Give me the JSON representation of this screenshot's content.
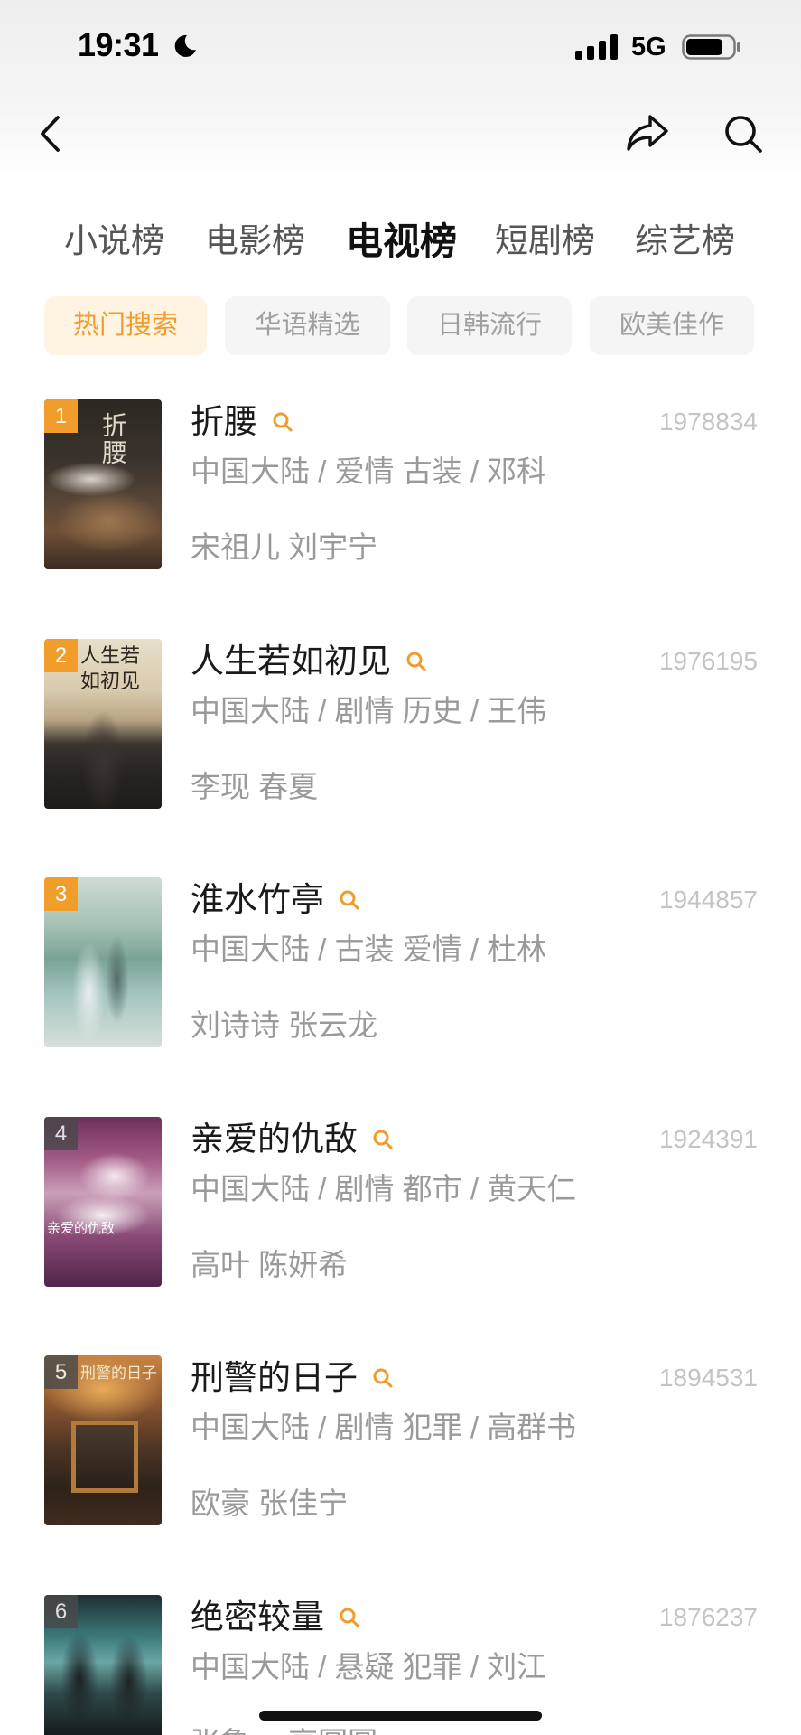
{
  "status_bar": {
    "time": "19:31",
    "network": "5G",
    "signal_bars": 4,
    "battery_level": 0.8,
    "icons": {
      "focus": "moon-icon",
      "signal": "signal-icon",
      "battery": "battery-icon"
    }
  },
  "nav": {
    "back_icon": "chevron-left-icon",
    "share_icon": "share-icon",
    "search_icon": "search-icon"
  },
  "category_tabs": [
    {
      "label": "小说榜",
      "active": false
    },
    {
      "label": "电影榜",
      "active": false
    },
    {
      "label": "电视榜",
      "active": true
    },
    {
      "label": "短剧榜",
      "active": false
    },
    {
      "label": "综艺榜",
      "active": false
    }
  ],
  "filter_chips": [
    {
      "label": "热门搜索",
      "active": true
    },
    {
      "label": "华语精选",
      "active": false
    },
    {
      "label": "日韩流行",
      "active": false
    },
    {
      "label": "欧美佳作",
      "active": false
    }
  ],
  "rank_list": [
    {
      "rank": "1",
      "title": "折腰",
      "count": "1978834",
      "meta": "中国大陆 / 爱情 古装 / 邓科",
      "cast": "宋祖儿 刘宇宁",
      "poster_text": "折腰"
    },
    {
      "rank": "2",
      "title": "人生若如初见",
      "count": "1976195",
      "meta": "中国大陆 / 剧情 历史 / 王伟",
      "cast": "李现 春夏",
      "poster_text": "人生若如初见"
    },
    {
      "rank": "3",
      "title": "淮水竹亭",
      "count": "1944857",
      "meta": "中国大陆 / 古装 爱情 / 杜林",
      "cast": "刘诗诗 张云龙"
    },
    {
      "rank": "4",
      "title": "亲爱的仇敌",
      "count": "1924391",
      "meta": "中国大陆 / 剧情 都市 / 黄天仁",
      "cast": "高叶 陈妍希",
      "poster_text": "亲爱的仇敌"
    },
    {
      "rank": "5",
      "title": "刑警的日子",
      "count": "1894531",
      "meta": "中国大陆 / 剧情 犯罪 / 高群书",
      "cast": "欧豪 张佳宁",
      "poster_text": "刑警的日子"
    },
    {
      "rank": "6",
      "title": "绝密较量",
      "count": "1876237",
      "meta": "中国大陆 / 悬疑 犯罪 / 刘江",
      "cast": "张鲁一 高圆圆"
    }
  ],
  "item_icon": "title-search-icon",
  "colors": {
    "accent": "#f19b2c",
    "chip_active_bg": "#fff3e2",
    "chip_bg": "#f5f5f5",
    "chip_text": "#a0a0a0",
    "title_text": "#1a1a1a",
    "secondary_text": "#9a9a9a",
    "count_text": "#c4c4c4",
    "badge_top": "#f19d2c",
    "badge_other": "#4a4a4a",
    "tab_text": "#555555",
    "tab_active_text": "#111111"
  }
}
